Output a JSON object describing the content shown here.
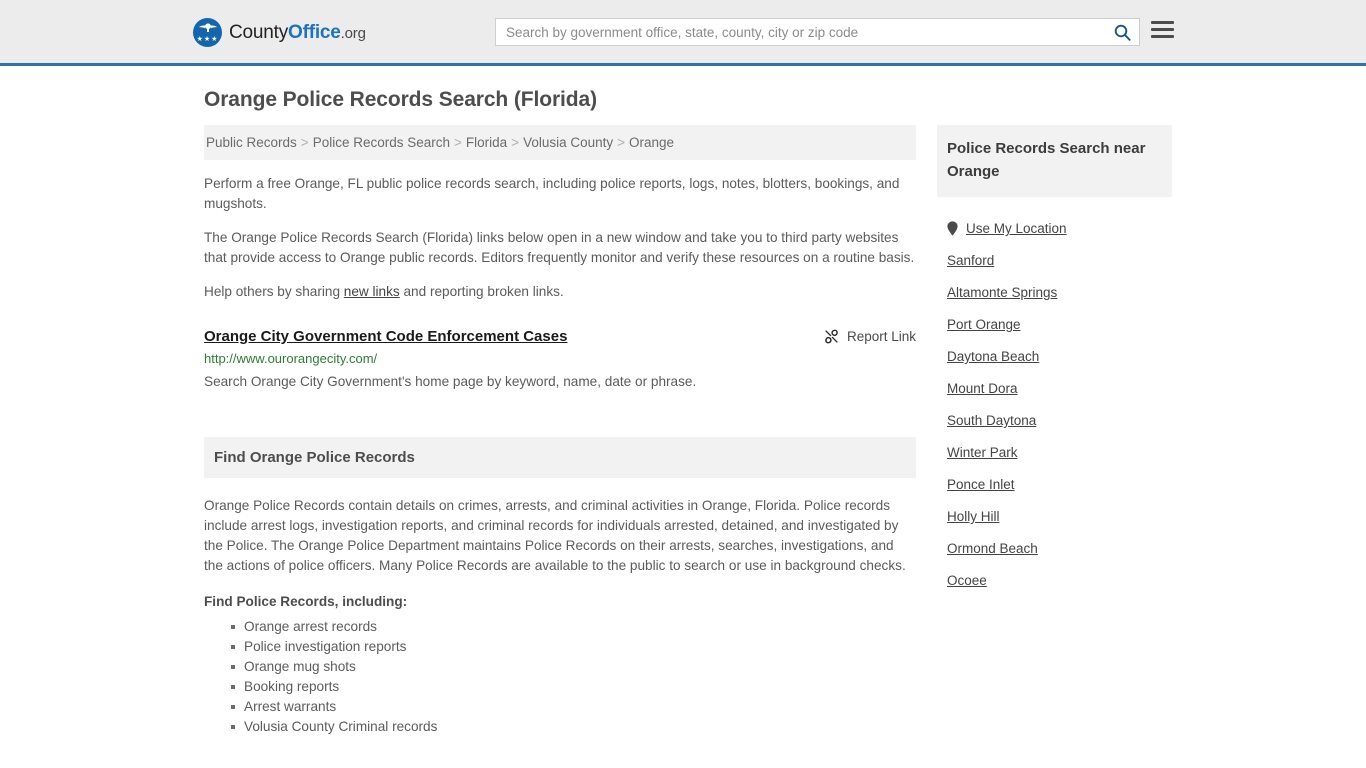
{
  "header": {
    "brand": {
      "part1": "County",
      "part2": "Office",
      "part3": ".org"
    },
    "search": {
      "placeholder": "Search by government office, state, county, city or zip code",
      "value": "",
      "button_label": "Search"
    },
    "menu_label": "Menu",
    "accent_color": "#3272a8",
    "background_color": "#ececec"
  },
  "page": {
    "title": "Orange Police Records Search (Florida)"
  },
  "breadcrumb": {
    "separator": ">",
    "items": [
      {
        "label": "Public Records"
      },
      {
        "label": "Police Records Search"
      },
      {
        "label": "Florida"
      },
      {
        "label": "Volusia County"
      },
      {
        "label": "Orange"
      }
    ]
  },
  "intro": {
    "p1": "Perform a free Orange, FL public police records search, including police reports, logs, notes, blotters, bookings, and mugshots.",
    "p2": "The Orange Police Records Search (Florida) links below open in a new window and take you to third party websites that provide access to Orange public records. Editors frequently monitor and verify these resources on a routine basis.",
    "p3_before": "Help others by sharing ",
    "p3_link": "new links",
    "p3_after": " and reporting broken links."
  },
  "result": {
    "title": "Orange City Government Code Enforcement Cases",
    "url": "http://www.ourorangecity.com/",
    "description": "Search Orange City Government's home page by keyword, name, date or phrase.",
    "report_label": "Report Link",
    "report_icon": "broken-link-icon",
    "url_color": "#2e7d32"
  },
  "section": {
    "heading": "Find Orange Police Records",
    "body": "Orange Police Records contain details on crimes, arrests, and criminal activities in Orange, Florida. Police records include arrest logs, investigation reports, and criminal records for individuals arrested, detained, and investigated by the Police. The Orange Police Department maintains Police Records on their arrests, searches, investigations, and the actions of police officers. Many Police Records are available to the public to search or use in background checks.",
    "list_label": "Find Police Records, including:",
    "list_items": [
      "Orange arrest records",
      "Police investigation reports",
      "Orange mug shots",
      "Booking reports",
      "Arrest warrants",
      "Volusia County Criminal records"
    ]
  },
  "sidebar": {
    "heading": "Police Records Search near Orange",
    "use_my_location": "Use My Location",
    "location_icon": "map-pin-icon",
    "places": [
      "Sanford",
      "Altamonte Springs",
      "Port Orange",
      "Daytona Beach",
      "Mount Dora",
      "South Daytona",
      "Winter Park",
      "Ponce Inlet",
      "Holly Hill",
      "Ormond Beach",
      "Ocoee"
    ]
  }
}
